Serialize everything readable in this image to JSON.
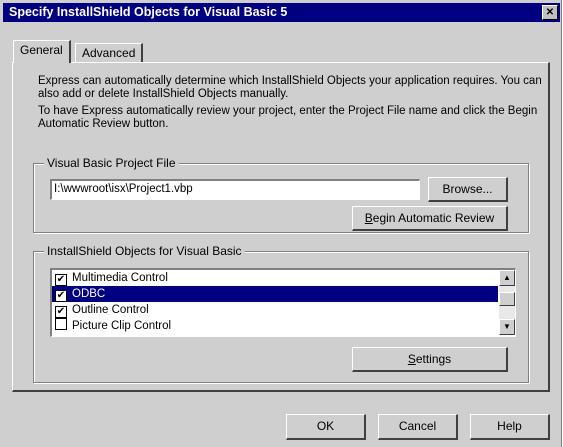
{
  "window": {
    "title": "Specify InstallShield Objects for Visual Basic 5",
    "close_glyph": "✕"
  },
  "tabs": [
    {
      "label": "General",
      "active": true
    },
    {
      "label": "Advanced",
      "active": false
    }
  ],
  "general": {
    "para1": "Express can automatically determine which InstallShield Objects your application requires.  You can also add or delete InstallShield Objects manually.",
    "para2": "To have Express automatically review your project, enter the Project File name and click the Begin Automatic Review button.",
    "vbp_group": {
      "legend": "Visual Basic Project File",
      "path_value": "I:\\wwwroot\\isx\\Project1.vbp",
      "browse_label": "Browse...",
      "review_label_first": "B",
      "review_label_rest": "egin Automatic Review"
    },
    "objects_group": {
      "legend": "InstallShield Objects for Visual Basic",
      "items": [
        {
          "label": "Multimedia Control",
          "checked": true,
          "selected": false
        },
        {
          "label": "ODBC",
          "checked": true,
          "selected": true
        },
        {
          "label": "Outline Control",
          "checked": true,
          "selected": false
        },
        {
          "label": "Picture Clip Control",
          "checked": false,
          "selected": false
        }
      ],
      "settings_label_first": "S",
      "settings_label_rest": "ettings"
    }
  },
  "buttons": {
    "ok": "OK",
    "cancel": "Cancel",
    "help": "Help"
  },
  "icons": {
    "check_glyph": "✔",
    "scroll_up_glyph": "▲",
    "scroll_down_glyph": "▼"
  }
}
